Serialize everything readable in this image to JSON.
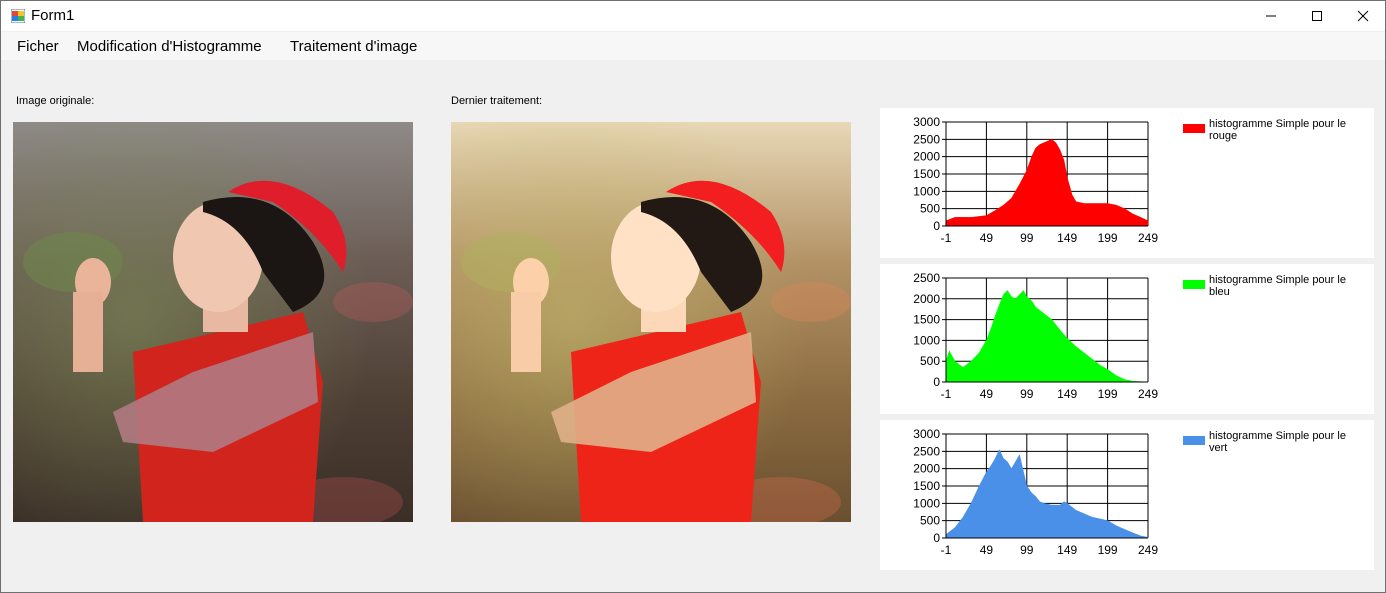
{
  "window": {
    "title": "Form1",
    "controls": {
      "minimize": "—",
      "maximize": "☐",
      "close": "✕"
    }
  },
  "menu": [
    "Ficher",
    "Modification d'Histogramme",
    "Traitement d'image"
  ],
  "captions": {
    "original": "Image originale:",
    "processed": "Dernier traitement:"
  },
  "charts": [
    {
      "legend": "histogramme Simple pour le rouge",
      "color": "#ff0000",
      "y_ticks": [
        "3000",
        "2500",
        "2000",
        "1500",
        "1000",
        "500",
        "0"
      ],
      "x_ticks": [
        "-1",
        "49",
        "99",
        "149",
        "199",
        "249"
      ]
    },
    {
      "legend": "histogramme Simple pour le bleu",
      "color": "#00ff00",
      "y_ticks": [
        "2500",
        "2000",
        "1500",
        "1000",
        "500",
        "0"
      ],
      "x_ticks": [
        "-1",
        "49",
        "99",
        "149",
        "199",
        "249"
      ]
    },
    {
      "legend": "histogramme Simple pour le vert",
      "color": "#4a8fe8",
      "y_ticks": [
        "3000",
        "2500",
        "2000",
        "1500",
        "1000",
        "500",
        "0"
      ],
      "x_ticks": [
        "-1",
        "49",
        "99",
        "149",
        "199",
        "249"
      ]
    }
  ],
  "chart_data": [
    {
      "type": "area",
      "series": [
        {
          "name": "histogramme Simple pour le rouge"
        }
      ],
      "x": [
        -1,
        10,
        30,
        49,
        60,
        70,
        80,
        90,
        99,
        105,
        110,
        115,
        120,
        125,
        130,
        135,
        140,
        145,
        149,
        155,
        160,
        170,
        180,
        190,
        199,
        210,
        220,
        230,
        240,
        249
      ],
      "values": [
        150,
        250,
        250,
        300,
        450,
        600,
        800,
        1200,
        1600,
        2000,
        2250,
        2350,
        2400,
        2450,
        2500,
        2400,
        2200,
        1900,
        1400,
        900,
        700,
        650,
        650,
        650,
        650,
        600,
        500,
        350,
        250,
        150
      ],
      "xlim": [
        -1,
        249
      ],
      "ylim": [
        0,
        3000
      ],
      "grid": true,
      "legend_position": "right"
    },
    {
      "type": "area",
      "series": [
        {
          "name": "histogramme Simple pour le bleu"
        }
      ],
      "x": [
        -1,
        3,
        10,
        20,
        30,
        40,
        49,
        55,
        60,
        65,
        70,
        75,
        80,
        85,
        90,
        95,
        99,
        105,
        110,
        120,
        130,
        140,
        149,
        160,
        170,
        180,
        190,
        199,
        210,
        220,
        230,
        240,
        249
      ],
      "values": [
        500,
        750,
        500,
        350,
        500,
        700,
        1000,
        1300,
        1600,
        1850,
        2100,
        2200,
        2050,
        2000,
        2100,
        2200,
        2050,
        1950,
        1800,
        1650,
        1500,
        1250,
        1050,
        850,
        700,
        550,
        400,
        300,
        150,
        60,
        20,
        10,
        0
      ],
      "xlim": [
        -1,
        249
      ],
      "ylim": [
        0,
        2500
      ],
      "grid": true,
      "legend_position": "right"
    },
    {
      "type": "area",
      "series": [
        {
          "name": "histogramme Simple pour le vert"
        }
      ],
      "x": [
        -1,
        10,
        20,
        30,
        40,
        49,
        55,
        60,
        65,
        70,
        75,
        80,
        85,
        90,
        95,
        99,
        105,
        110,
        115,
        120,
        130,
        140,
        145,
        149,
        160,
        170,
        180,
        190,
        199,
        210,
        220,
        230,
        240,
        249
      ],
      "values": [
        100,
        300,
        600,
        1000,
        1500,
        1900,
        2100,
        2300,
        2550,
        2300,
        2200,
        2000,
        2200,
        2400,
        1900,
        1500,
        1300,
        1200,
        1050,
        1000,
        950,
        950,
        1050,
        1000,
        800,
        700,
        600,
        550,
        500,
        350,
        250,
        150,
        60,
        20
      ],
      "xlim": [
        -1,
        249
      ],
      "ylim": [
        0,
        3000
      ],
      "grid": true,
      "legend_position": "right"
    }
  ]
}
